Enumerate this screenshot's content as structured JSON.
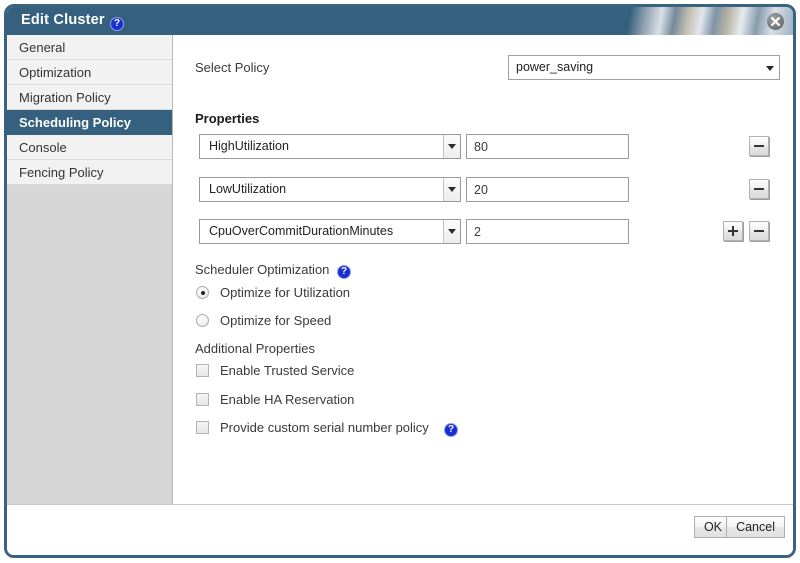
{
  "window": {
    "title": "Edit Cluster",
    "title_help_icon": "help-icon",
    "close_icon": "close-icon"
  },
  "sidebar": {
    "items": [
      {
        "label": "General",
        "selected": false
      },
      {
        "label": "Optimization",
        "selected": false
      },
      {
        "label": "Migration Policy",
        "selected": false
      },
      {
        "label": "Scheduling Policy",
        "selected": true
      },
      {
        "label": "Console",
        "selected": false
      },
      {
        "label": "Fencing Policy",
        "selected": false
      }
    ]
  },
  "main": {
    "select_policy_label": "Select Policy",
    "select_policy_value": "power_saving",
    "properties_heading": "Properties",
    "property_rows": [
      {
        "name": "HighUtilization",
        "value": "80",
        "has_add": false,
        "has_remove": true
      },
      {
        "name": "LowUtilization",
        "value": "20",
        "has_add": false,
        "has_remove": true
      },
      {
        "name": "CpuOverCommitDurationMinutes",
        "value": "2",
        "has_add": true,
        "has_remove": true
      }
    ],
    "add_button_label": "+",
    "remove_button_label": "-",
    "scheduler_optimization_label": "Scheduler Optimization",
    "scheduler_optimization_help_icon": "help-icon",
    "radio_options": [
      {
        "label": "Optimize for Utilization",
        "checked": true
      },
      {
        "label": "Optimize for Speed",
        "checked": false
      }
    ],
    "additional_properties_label": "Additional Properties",
    "checkbox_options": [
      {
        "label": "Enable Trusted Service",
        "checked": false,
        "help": false
      },
      {
        "label": "Enable HA Reservation",
        "checked": false,
        "help": false
      },
      {
        "label": "Provide custom serial number policy",
        "checked": false,
        "help": true
      }
    ]
  },
  "footer": {
    "ok_label": "OK",
    "cancel_label": "Cancel"
  },
  "colors": {
    "titlebar": "#35617e",
    "selected_item": "#35617e",
    "help_blue": "#1a2fd0",
    "sidebar_bg": "#d6d6d6",
    "item_bg": "#f2f2f2"
  }
}
